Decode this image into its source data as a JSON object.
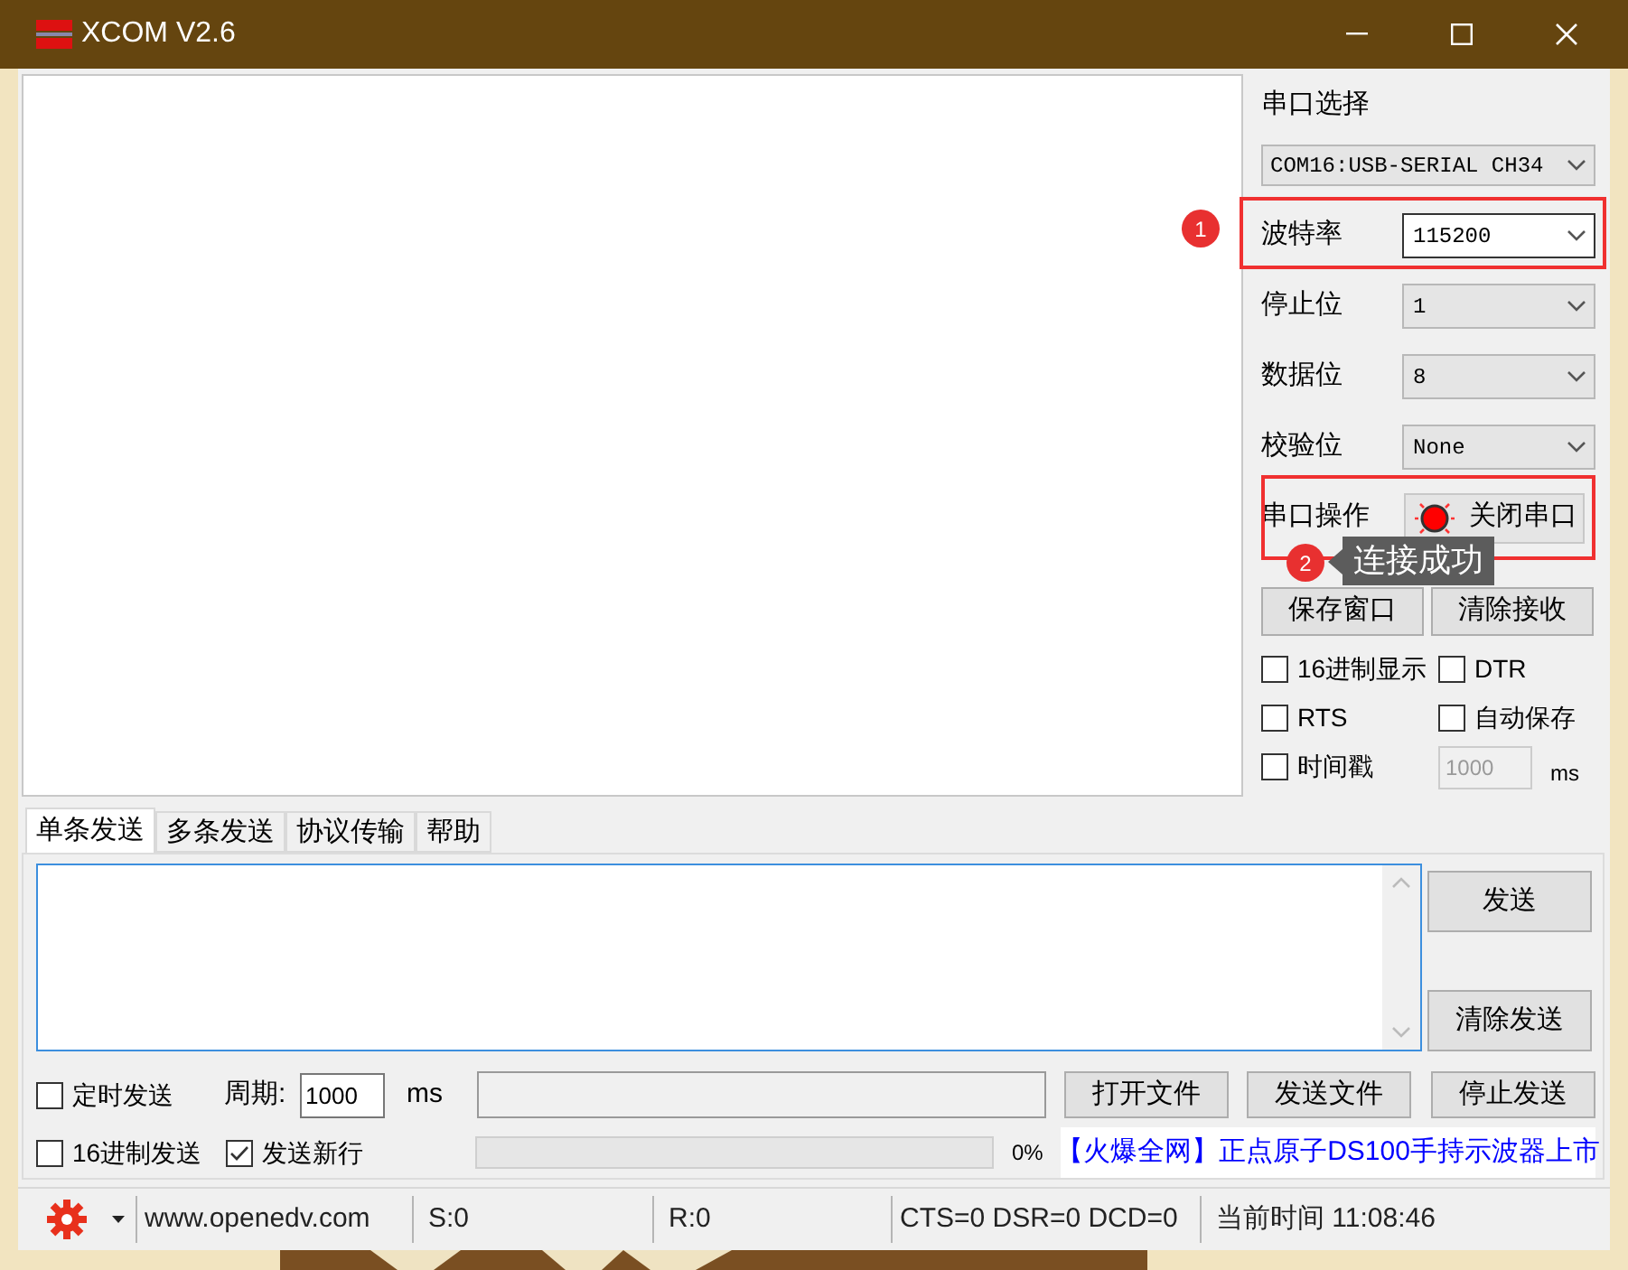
{
  "window": {
    "title": "XCOM V2.6"
  },
  "serial_panel": {
    "heading": "串口选择",
    "port": {
      "value": "COM16:USB-SERIAL CH34"
    },
    "settings": [
      {
        "label": "波特率",
        "value": "115200",
        "focused": true
      },
      {
        "label": "停止位",
        "value": "1",
        "focused": false
      },
      {
        "label": "数据位",
        "value": "8",
        "focused": false
      },
      {
        "label": "校验位",
        "value": "None",
        "focused": false
      }
    ],
    "operation": {
      "label": "串口操作",
      "button": "关闭串口",
      "open": true
    },
    "buttons": [
      "保存窗口",
      "清除接收"
    ],
    "options": [
      {
        "label": "16进制显示",
        "checked": false
      },
      {
        "label": "DTR",
        "checked": false
      },
      {
        "label": "RTS",
        "checked": false
      },
      {
        "label": "自动保存",
        "checked": false
      },
      {
        "label": "时间戳",
        "checked": false
      }
    ],
    "timestamp": {
      "value": "1000",
      "unit": "ms",
      "disabled": true
    }
  },
  "tabs": [
    {
      "label": "单条发送",
      "selected": true
    },
    {
      "label": "多条发送",
      "selected": false
    },
    {
      "label": "协议传输",
      "selected": false
    },
    {
      "label": "帮助",
      "selected": false
    }
  ],
  "send_panel": {
    "buttons": [
      "发送",
      "清除发送"
    ],
    "timed_send": {
      "label": "定时发送",
      "checked": false
    },
    "period": {
      "label": "周期:",
      "value": "1000",
      "unit": "ms"
    },
    "file_buttons": [
      "打开文件",
      "发送文件",
      "停止发送"
    ],
    "hex_send": {
      "label": "16进制发送",
      "checked": false
    },
    "newline": {
      "label": "发送新行",
      "checked": true
    },
    "progress": {
      "level": 0,
      "reading": "0%"
    },
    "ad_link": "【火爆全网】正点原子DS100手持示波器上市"
  },
  "status_bar": {
    "url": "www.openedv.com",
    "sent": "S:0",
    "received": "R:0",
    "lines": "CTS=0 DSR=0 DCD=0",
    "time": "当前时间 11:08:46"
  },
  "annotations": [
    {
      "number": "1"
    },
    {
      "number": "2",
      "tooltip": "连接成功"
    }
  ]
}
